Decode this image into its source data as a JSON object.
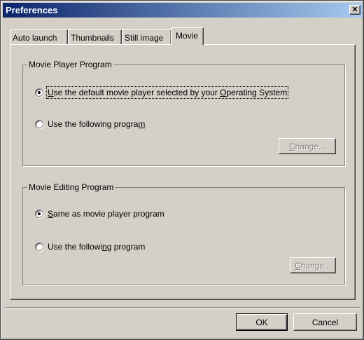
{
  "window": {
    "title": "Preferences",
    "close_glyph": "✕"
  },
  "tabs": [
    {
      "label": "Auto launch",
      "active": false
    },
    {
      "label": "Thumbnails",
      "active": false
    },
    {
      "label": "Still image",
      "active": false
    },
    {
      "label": "Movie",
      "active": true
    }
  ],
  "player_group": {
    "title": "Movie Player Program",
    "option_default": {
      "pre": "",
      "accel": "U",
      "post": "se the default movie player selected by your ",
      "accel2": "O",
      "post2": "perating System",
      "checked": true
    },
    "option_custom": {
      "pre": "Use the following progra",
      "accel": "m",
      "post": "",
      "checked": false
    },
    "change_button": {
      "pre": "",
      "accel": "C",
      "post": "hange...",
      "enabled": false
    }
  },
  "editing_group": {
    "title": "Movie Editing Program",
    "option_same": {
      "pre": "",
      "accel": "S",
      "post": "ame as movie player program",
      "checked": true
    },
    "option_custom": {
      "pre": "Use the followi",
      "accel": "n",
      "post": "g program",
      "checked": false
    },
    "change_button": {
      "pre": "",
      "accel": "C",
      "post": "hange...",
      "enabled": false
    }
  },
  "footer": {
    "ok_label": "OK",
    "cancel_label": "Cancel"
  }
}
